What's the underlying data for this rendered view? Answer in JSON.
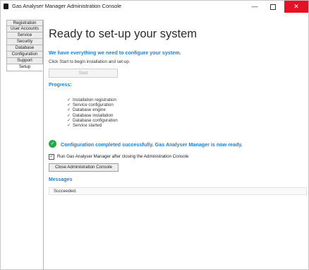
{
  "window": {
    "title": "Gas Analyser Manager Administration Console",
    "controls": {
      "minimize": "—",
      "close": "✕"
    },
    "accent_color": "#1f7fd1",
    "close_color": "#e81123"
  },
  "sidebar": {
    "items": [
      {
        "label": "Registration"
      },
      {
        "label": "User Accounts"
      },
      {
        "label": "Service"
      },
      {
        "label": "Security"
      },
      {
        "label": "Database"
      },
      {
        "label": "Configuration"
      },
      {
        "label": "Support"
      },
      {
        "label": "Setup",
        "active": true
      }
    ]
  },
  "main": {
    "heading": "Ready to set-up your system",
    "subheading": "We have everything we need to configure your system.",
    "instruction": "Click Start to begin installation and set-up.",
    "start_button": "Start",
    "progress_label": "Progress:",
    "steps": [
      "Installation registration",
      "Service configuration",
      "Database engine",
      "Database installation",
      "Database configuration",
      "Service started"
    ],
    "success_message": "Configuration completed successfully. Gas Analyser Manager is now ready.",
    "run_after_close_label": "Run Gas Analyser Manager after closing the Administration Console",
    "run_after_close_checked": true,
    "close_button": "Close Administration Console",
    "messages_label": "Messages",
    "message_text": "Succeeded."
  }
}
